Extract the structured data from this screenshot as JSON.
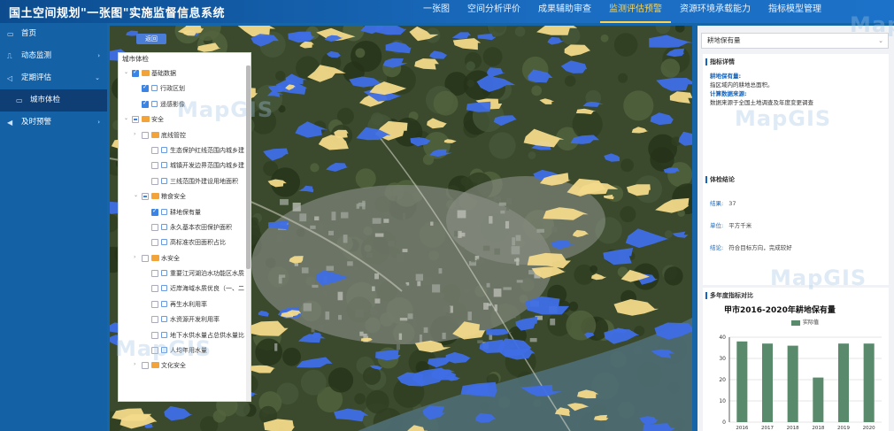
{
  "header": {
    "title": "国土空间规划\"一张图\"实施监督信息系统",
    "nav": [
      "一张图",
      "空间分析评价",
      "成果辅助审查",
      "监测评估预警",
      "资源环境承载能力",
      "指标模型管理"
    ],
    "active_index": 3
  },
  "sidebar": {
    "items": [
      {
        "label": "首页",
        "icon": "monitor-icon",
        "arrow": ""
      },
      {
        "label": "动态监测",
        "icon": "chart-icon",
        "arrow": "›"
      },
      {
        "label": "定期评估",
        "icon": "send-icon",
        "arrow": "⌄"
      },
      {
        "label": "城市体检",
        "icon": "screen-icon",
        "arrow": "",
        "sub": true
      },
      {
        "label": "及时预警",
        "icon": "alert-icon",
        "arrow": "›"
      }
    ]
  },
  "map": {
    "button_label": "返回"
  },
  "tree": {
    "title": "城市体检",
    "nodes": [
      {
        "label": "基础数据",
        "level": 0,
        "arrow": "⌄",
        "check": "on",
        "folder": true
      },
      {
        "label": "行政区划",
        "level": 1,
        "arrow": "",
        "check": "on",
        "folder": false
      },
      {
        "label": "遥感影像",
        "level": 1,
        "arrow": "",
        "check": "on",
        "folder": false
      },
      {
        "label": "安全",
        "level": 0,
        "arrow": "⌄",
        "check": "part",
        "folder": true
      },
      {
        "label": "底线管控",
        "level": 1,
        "arrow": "›",
        "check": "off",
        "folder": true
      },
      {
        "label": "生态保护红线范围内城乡建",
        "level": 2,
        "arrow": "",
        "check": "off",
        "folder": false
      },
      {
        "label": "城镇开发边界范围内城乡建",
        "level": 2,
        "arrow": "",
        "check": "off",
        "folder": false
      },
      {
        "label": "三线范围外建设用地面积",
        "level": 2,
        "arrow": "",
        "check": "off",
        "folder": false
      },
      {
        "label": "粮食安全",
        "level": 1,
        "arrow": "⌄",
        "check": "part",
        "folder": true
      },
      {
        "label": "耕地保有量",
        "level": 2,
        "arrow": "",
        "check": "on",
        "folder": false
      },
      {
        "label": "永久基本农田保护面积",
        "level": 2,
        "arrow": "",
        "check": "off",
        "folder": false
      },
      {
        "label": "高标准农田面积占比",
        "level": 2,
        "arrow": "",
        "check": "off",
        "folder": false
      },
      {
        "label": "水安全",
        "level": 1,
        "arrow": "›",
        "check": "off",
        "folder": true
      },
      {
        "label": "重要江河湖泊水功能区水质",
        "level": 2,
        "arrow": "",
        "check": "off",
        "folder": false
      },
      {
        "label": "近岸海域水质优良（一、二",
        "level": 2,
        "arrow": "",
        "check": "off",
        "folder": false
      },
      {
        "label": "再生水利用率",
        "level": 2,
        "arrow": "",
        "check": "off",
        "folder": false
      },
      {
        "label": "水资源开发利用率",
        "level": 2,
        "arrow": "",
        "check": "off",
        "folder": false
      },
      {
        "label": "地下水供水量占总供水量比",
        "level": 2,
        "arrow": "",
        "check": "off",
        "folder": false
      },
      {
        "label": "人均年用水量",
        "level": 2,
        "arrow": "",
        "check": "off",
        "folder": false
      },
      {
        "label": "文化安全",
        "level": 1,
        "arrow": "›",
        "check": "off",
        "folder": true
      }
    ]
  },
  "right": {
    "select_value": "耕地保有量",
    "detail": {
      "title": "指标详情",
      "def_label": "耕地保有量:",
      "def_text": "指区域内的耕地总面积。",
      "src_label": "计算数据来源:",
      "src_text": "数据来源于全国土地调查及年度变更调查"
    },
    "result": {
      "title": "体检结论",
      "rows": [
        {
          "k": "结果:",
          "v": "37"
        },
        {
          "k": "单位:",
          "v": "平方千米"
        },
        {
          "k": "结论:",
          "v": "符合目标方向，完成较好"
        }
      ]
    },
    "compare": {
      "title": "多年度指标对比"
    }
  },
  "chart_data": {
    "type": "bar",
    "title": "甲市2016-2020年耕地保有量",
    "categories": [
      "2016",
      "2017",
      "2018",
      "2018",
      "2019",
      "2020"
    ],
    "series": [
      {
        "name": "实际值",
        "values": [
          38,
          37,
          36,
          21,
          37,
          37
        ]
      }
    ],
    "ylim": [
      0,
      40
    ],
    "yticks": [
      0,
      10,
      20,
      30,
      40
    ],
    "color": "#5a8a6c",
    "legend": "top"
  },
  "watermark": "MapGIS",
  "colors": {
    "header": "#1a6cc0",
    "sidebar": "#1461a6",
    "active_nav": "#ffd34a",
    "map_blue": "#3e6ee6",
    "map_yellow": "#f3d98a"
  }
}
